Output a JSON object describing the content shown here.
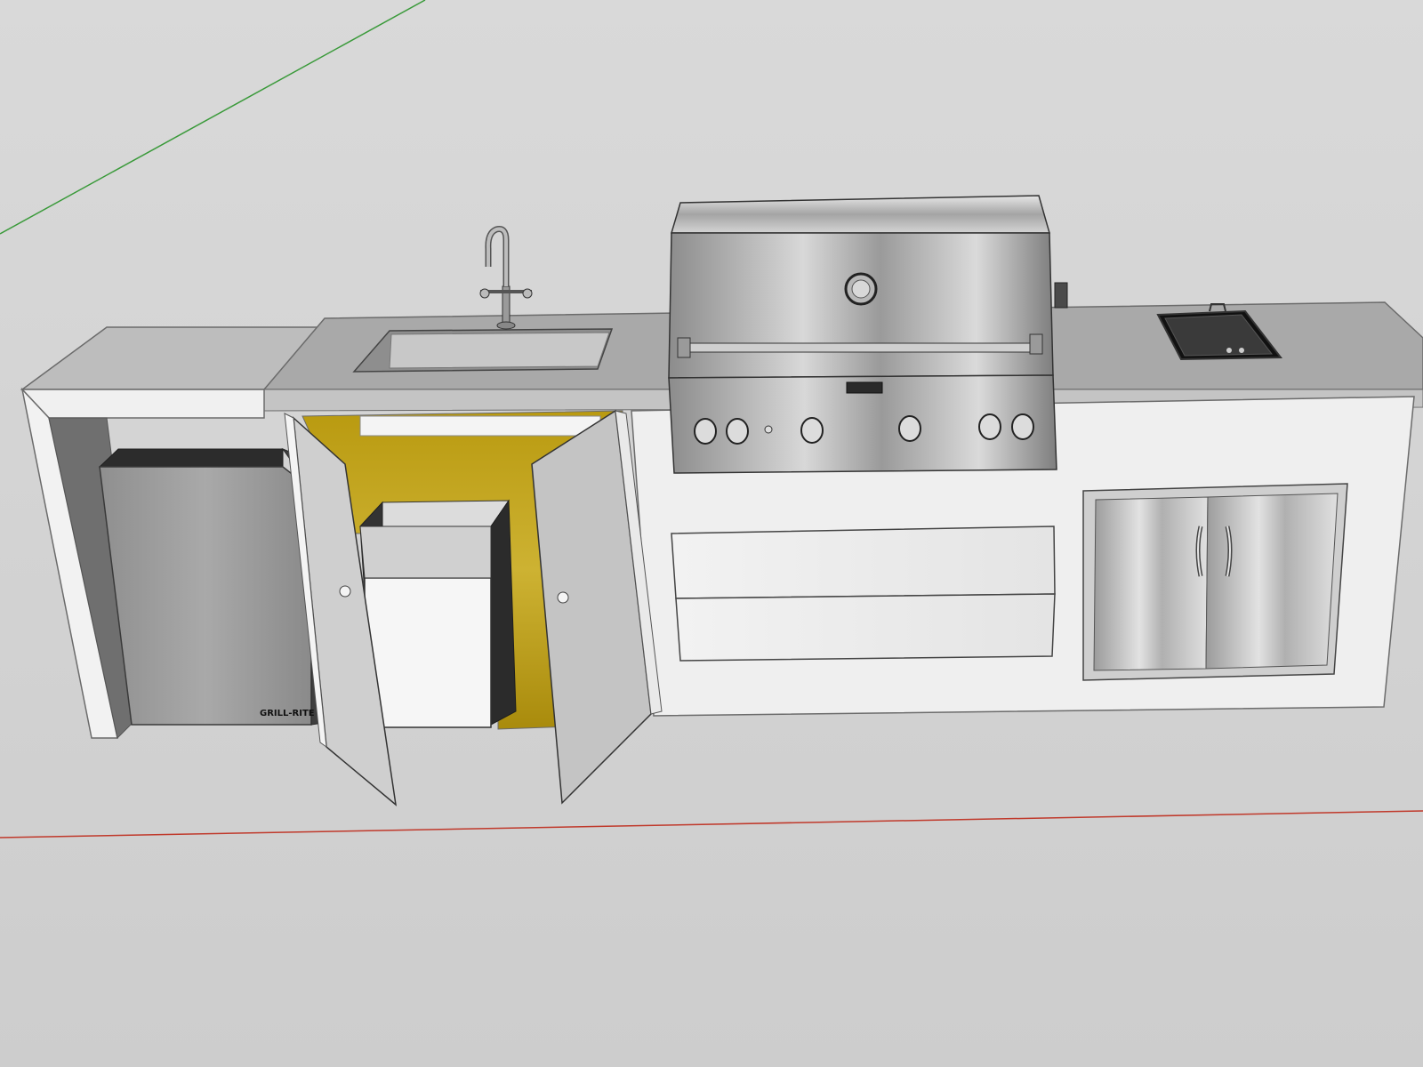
{
  "viewport": {
    "kind": "3d-model-viewport",
    "background_color": "#d4d4d4",
    "axis_colors": {
      "green_axis": "#3a9a3a",
      "red_axis": "#c0392b"
    }
  },
  "model": {
    "objects": [
      {
        "name": "counter-island",
        "role": "outdoor kitchen base"
      },
      {
        "name": "refrigerator",
        "badge_text": "GRILL-RITE"
      },
      {
        "name": "sink",
        "fixture": "faucet-icon"
      },
      {
        "name": "open-cabinet",
        "doors": 2
      },
      {
        "name": "trash-bin"
      },
      {
        "name": "grill",
        "knob_count": 6
      },
      {
        "name": "storage-drawers",
        "count": 2
      },
      {
        "name": "double-access-doors"
      },
      {
        "name": "side-burner"
      }
    ],
    "colors": {
      "counter_top": "#a9a9a9",
      "counter_front": "#ececec",
      "stainless": "#b9b9b9",
      "cabinet_interior": "#c9ae2a"
    }
  }
}
